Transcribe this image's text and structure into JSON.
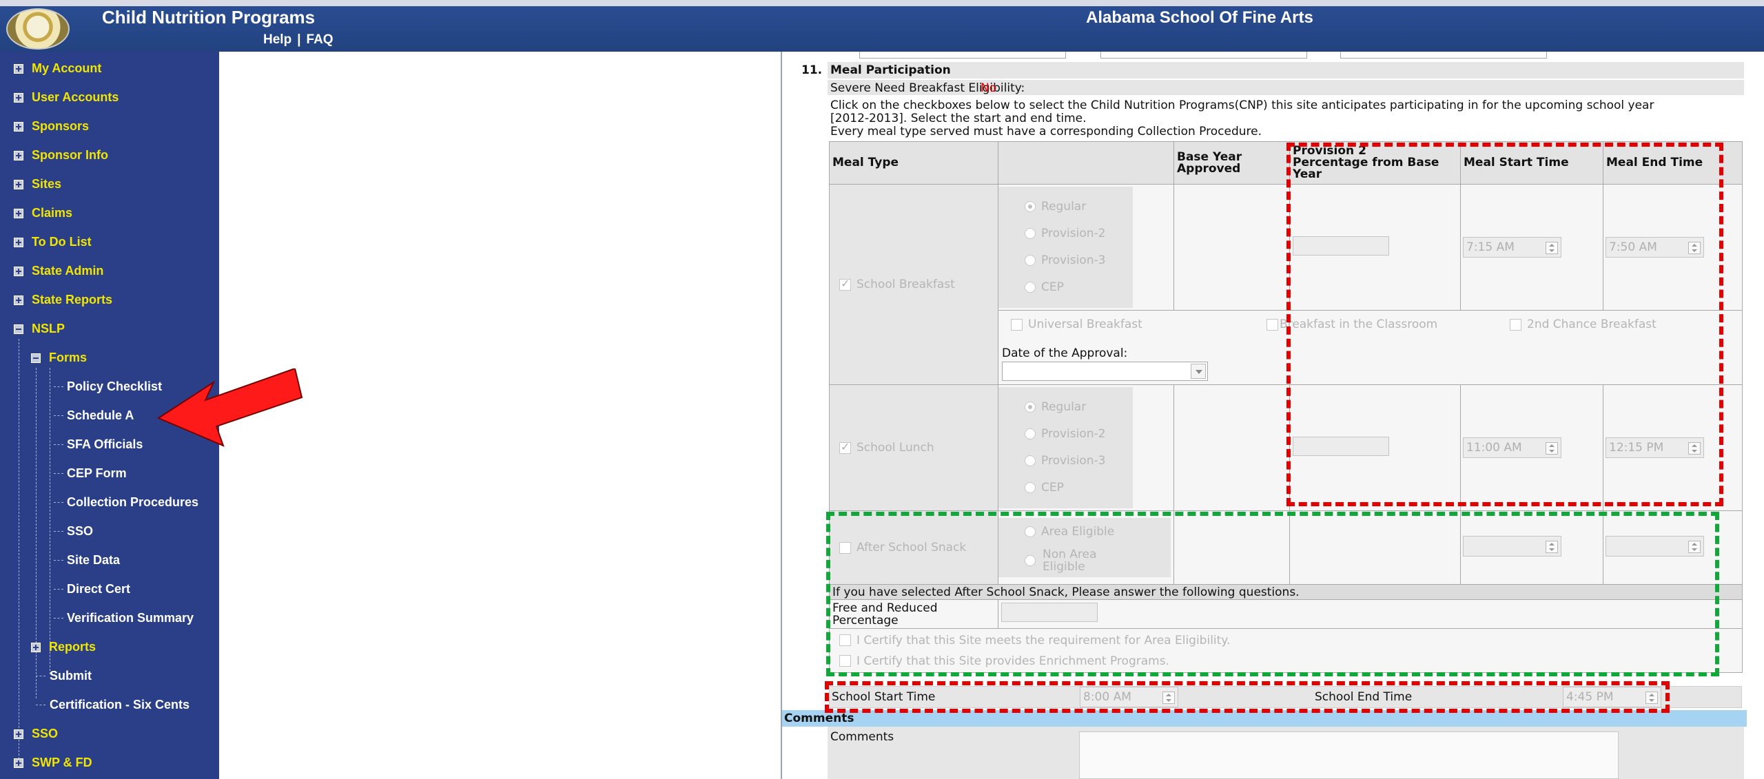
{
  "header": {
    "app_title": "Child Nutrition Programs",
    "help": "Help",
    "faq": "FAQ",
    "separator": "|",
    "school_name": "Alabama School Of Fine Arts"
  },
  "sidebar": {
    "top_items": [
      "My Account",
      "User Accounts",
      "Sponsors",
      "Sponsor Info",
      "Sites",
      "Claims",
      "To Do List",
      "State Admin",
      "State Reports",
      "NSLP"
    ],
    "forms_label": "Forms",
    "forms_items": [
      "Policy Checklist",
      "Schedule A",
      "SFA Officials",
      "CEP Form",
      "Collection Procedures",
      "SSO",
      "Site Data",
      "Direct Cert",
      "Verification Summary"
    ],
    "reports_label": "Reports",
    "nslp_items": [
      "Submit",
      "Certification - Six Cents"
    ],
    "bottom_items": [
      "SSO",
      "SWP & FD"
    ]
  },
  "form": {
    "section_number": "11.",
    "section_title": "Meal Participation",
    "severe_need_label": "Severe Need Breakfast Eligibility:",
    "severe_need_value": "No",
    "instructions_1": "Click on the checkboxes below to select the Child Nutrition Programs(CNP) this site anticipates participating in for the upcoming school year",
    "instructions_2": "[2012-2013]. Select the start and end time.",
    "instructions_3": "Every meal type served must have a corresponding Collection Procedure.",
    "columns": {
      "meal_type": "Meal Type",
      "base_year_1": "Base Year",
      "base_year_2": "Approved",
      "prov2_1": "Provision 2",
      "prov2_2": "Percentage from Base",
      "prov2_3": "Year",
      "start": "Meal Start Time",
      "end": "Meal End Time"
    },
    "breakfast": {
      "label": "School Breakfast",
      "options": [
        "Regular",
        "Provision-2",
        "Provision-3",
        "CEP"
      ],
      "start": "7:15 AM",
      "end": "7:50 AM",
      "universal": "Universal Breakfast",
      "classroom": "Breakfast in the Classroom",
      "second_chance": "2nd Chance Breakfast",
      "approval_date_label": "Date of the Approval:"
    },
    "lunch": {
      "label": "School Lunch",
      "options": [
        "Regular",
        "Provision-2",
        "Provision-3",
        "CEP"
      ],
      "start": "11:00 AM",
      "end": "12:15 PM"
    },
    "snack": {
      "label": "After School Snack",
      "area_eligible": "Area Eligible",
      "non_area_1": "Non Area",
      "non_area_2": "Eligible",
      "question_text": "If you have selected After School Snack, Please answer the following questions.",
      "free_reduced_1": "Free and Reduced",
      "free_reduced_2": "Percentage",
      "certify_area": "I Certify that this Site meets the requirement for Area Eligibility.",
      "certify_enrichment": "I Certify that this Site provides Enrichment Programs."
    },
    "school_start_label": "School Start Time",
    "school_start_value": "8:00 AM",
    "school_end_label": "School End Time",
    "school_end_value": "4:45 PM",
    "comments_header": "Comments",
    "comments_label": "Comments"
  },
  "colors": {
    "header_bg": "#22427f",
    "sidebar_bg": "#2a3f87",
    "nav_text": "#f2e600",
    "highlight_red": "#e50000",
    "highlight_green": "#11a83a",
    "comments_bar": "#a7d3f2"
  }
}
